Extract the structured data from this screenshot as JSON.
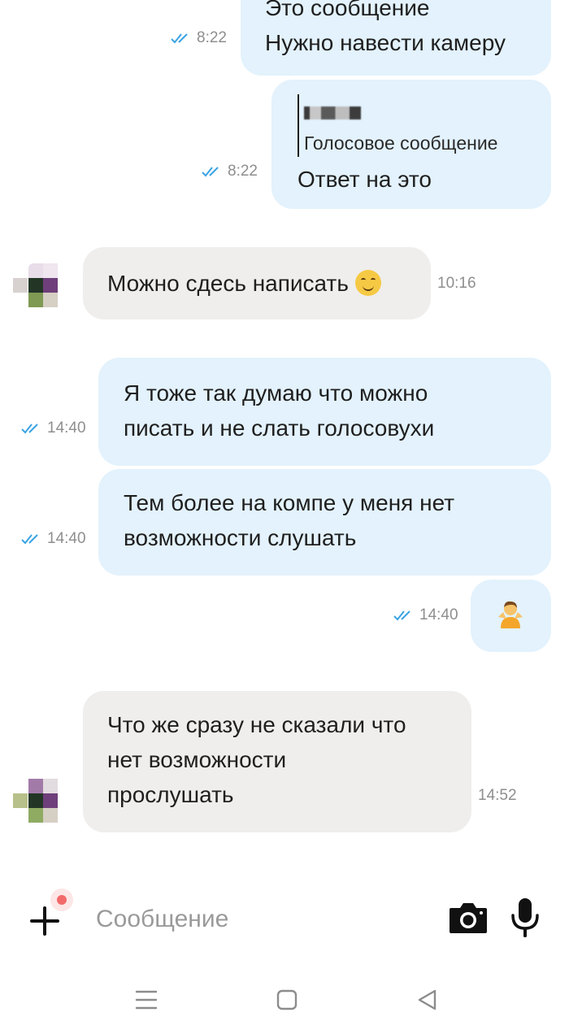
{
  "messages": [
    {
      "text_top": "Это сообщение",
      "text": "Нужно навести камеру",
      "time": "8:22"
    },
    {
      "reply_label": "Голосовое сообщение",
      "text": "Ответ на это",
      "time": "8:22"
    },
    {
      "text": "Можно сдесь написать",
      "time": "10:16"
    },
    {
      "line1": "Я тоже так думаю что можно",
      "line2": "писать и не слать голосовухи",
      "time": "14:40"
    },
    {
      "line1": "Тем более на компе у меня нет",
      "line2": "возможности слушать",
      "time": "14:40"
    },
    {
      "emoji": "person-shrugging",
      "time": "14:40"
    },
    {
      "line1": "Что же сразу не сказали что",
      "line2": "нет возможности",
      "line3": "прослушать",
      "time": "14:52"
    }
  ],
  "composer": {
    "placeholder": "Сообщение"
  },
  "colors": {
    "outgoing": "#e3f2fc",
    "incoming": "#efeeec",
    "ticks": "#3aa3e3",
    "recording_dot": "#f36a6a"
  },
  "icons": [
    "double-check-icon",
    "smiling-face-emoji",
    "person-shrugging-emoji",
    "plus-icon",
    "camera-icon",
    "microphone-icon",
    "menu-icon",
    "home-icon",
    "back-icon"
  ]
}
